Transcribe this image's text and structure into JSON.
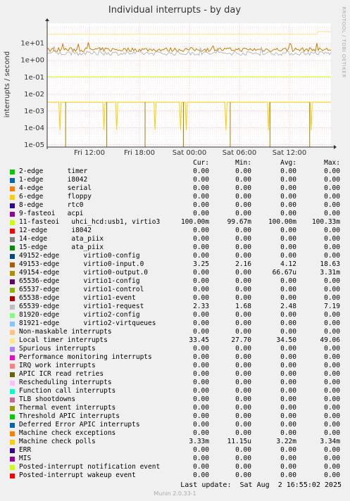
{
  "chart_data": {
    "type": "line",
    "title": "Individual interrupts - by day",
    "ylabel": "interrupts / second",
    "side_text": "RRDTOOL / TOBI OETIKER",
    "y_scale": "log",
    "ylim": [
      7e-06,
      150
    ],
    "y_ticks": [
      {
        "value": 10,
        "label": "1e+01"
      },
      {
        "value": 1,
        "label": "1e+00"
      },
      {
        "value": 0.1,
        "label": "1e-01"
      },
      {
        "value": 0.01,
        "label": "1e-02"
      },
      {
        "value": 0.001,
        "label": "1e-03"
      },
      {
        "value": 0.0001,
        "label": "1e-04"
      },
      {
        "value": 1e-05,
        "label": "1e-05"
      }
    ],
    "x_ticks": [
      "Fri 12:00",
      "Fri 18:00",
      "Sat 00:00",
      "Sat 06:00",
      "Sat 12:00"
    ],
    "grid": true,
    "series": [
      {
        "name": "Local timer interrupts",
        "color": "#ffe680",
        "level": 34.5,
        "style": "flat"
      },
      {
        "name": "49153-edge",
        "color": "#cc7a00",
        "level": 4.12,
        "style": "noisy"
      },
      {
        "name": "65539-edge",
        "color": "#b8b8b8",
        "level": 2.48,
        "style": "noisy"
      },
      {
        "name": "11-fasteoi",
        "color": "#ccff00",
        "level": 0.1,
        "style": "flat"
      },
      {
        "name": "Machine check polls",
        "color": "#ffcc00",
        "level": 0.00322,
        "style": "dips"
      },
      {
        "name": "49154-edge",
        "color": "#a08000",
        "level": 6.67e-05,
        "style": "spikes"
      }
    ]
  },
  "legend": {
    "headers": {
      "cur": "Cur:",
      "min": "Min:",
      "avg": "Avg:",
      "max": "Max:"
    },
    "rows": [
      {
        "name": "2-edge      timer",
        "color": "#00cc00",
        "cur": "0.00",
        "min": "0.00",
        "avg": "0.00",
        "max": "0.00"
      },
      {
        "name": "1-edge      i8042",
        "color": "#0066b3",
        "cur": "0.00",
        "min": "0.00",
        "avg": "0.00",
        "max": "0.00"
      },
      {
        "name": "4-edge      serial",
        "color": "#ff8000",
        "cur": "0.00",
        "min": "0.00",
        "avg": "0.00",
        "max": "0.00"
      },
      {
        "name": "6-edge      floppy",
        "color": "#ffcc00",
        "cur": "0.00",
        "min": "0.00",
        "avg": "0.00",
        "max": "0.00"
      },
      {
        "name": "8-edge      rtc0",
        "color": "#330099",
        "cur": "0.00",
        "min": "0.00",
        "avg": "0.00",
        "max": "0.00"
      },
      {
        "name": "9-fasteoi   acpi",
        "color": "#990099",
        "cur": "0.00",
        "min": "0.00",
        "avg": "0.00",
        "max": "0.00"
      },
      {
        "name": "11-fasteoi   uhci_hcd:usb1, virtio3",
        "color": "#ccff00",
        "cur": "100.00m",
        "min": "99.67m",
        "avg": "100.00m",
        "max": "100.33m"
      },
      {
        "name": "12-edge      i8042",
        "color": "#ff0000",
        "cur": "0.00",
        "min": "0.00",
        "avg": "0.00",
        "max": "0.00"
      },
      {
        "name": "14-edge      ata_piix",
        "color": "#808080",
        "cur": "0.00",
        "min": "0.00",
        "avg": "0.00",
        "max": "0.00"
      },
      {
        "name": "15-edge      ata_piix",
        "color": "#008f00",
        "cur": "0.00",
        "min": "0.00",
        "avg": "0.00",
        "max": "0.00"
      },
      {
        "name": "49152-edge      virtio0-config",
        "color": "#00487d",
        "cur": "0.00",
        "min": "0.00",
        "avg": "0.00",
        "max": "0.00"
      },
      {
        "name": "49153-edge      virtio0-input.0",
        "color": "#b35a00",
        "cur": "3.25",
        "min": "2.16",
        "avg": "4.12",
        "max": "18.63"
      },
      {
        "name": "49154-edge      virtio0-output.0",
        "color": "#b38f00",
        "cur": "0.00",
        "min": "0.00",
        "avg": "66.67u",
        "max": "3.31m"
      },
      {
        "name": "65536-edge      virtio1-config",
        "color": "#6b006b",
        "cur": "0.00",
        "min": "0.00",
        "avg": "0.00",
        "max": "0.00"
      },
      {
        "name": "65537-edge      virtio1-control",
        "color": "#8fb300",
        "cur": "0.00",
        "min": "0.00",
        "avg": "0.00",
        "max": "0.00"
      },
      {
        "name": "65538-edge      virtio1-event",
        "color": "#b30000",
        "cur": "0.00",
        "min": "0.00",
        "avg": "0.00",
        "max": "0.00"
      },
      {
        "name": "65539-edge      virtio1-request",
        "color": "#bebebe",
        "cur": "2.33",
        "min": "1.68",
        "avg": "2.48",
        "max": "7.19"
      },
      {
        "name": "81920-edge      virtio2-config",
        "color": "#80ff80",
        "cur": "0.00",
        "min": "0.00",
        "avg": "0.00",
        "max": "0.00"
      },
      {
        "name": "81921-edge      virtio2-virtqueues",
        "color": "#80c9ff",
        "cur": "0.00",
        "min": "0.00",
        "avg": "0.00",
        "max": "0.00"
      },
      {
        "name": "Non-maskable interrupts",
        "color": "#ffc080",
        "cur": "0.00",
        "min": "0.00",
        "avg": "0.00",
        "max": "0.00"
      },
      {
        "name": "Local timer interrupts",
        "color": "#ffe680",
        "cur": "33.45",
        "min": "27.70",
        "avg": "34.50",
        "max": "49.06"
      },
      {
        "name": "Spurious interrupts",
        "color": "#aa80ff",
        "cur": "0.00",
        "min": "0.00",
        "avg": "0.00",
        "max": "0.00"
      },
      {
        "name": "Performance monitoring interrupts",
        "color": "#ee00cc",
        "cur": "0.00",
        "min": "0.00",
        "avg": "0.00",
        "max": "0.00"
      },
      {
        "name": "IRQ work interrupts",
        "color": "#ff8080",
        "cur": "0.00",
        "min": "0.00",
        "avg": "0.00",
        "max": "0.00"
      },
      {
        "name": "APIC ICR read retries",
        "color": "#666600",
        "cur": "0.00",
        "min": "0.00",
        "avg": "0.00",
        "max": "0.00"
      },
      {
        "name": "Rescheduling interrupts",
        "color": "#ffbfff",
        "cur": "0.00",
        "min": "0.00",
        "avg": "0.00",
        "max": "0.00"
      },
      {
        "name": "Function call interrupts",
        "color": "#00ffcc",
        "cur": "0.00",
        "min": "0.00",
        "avg": "0.00",
        "max": "0.00"
      },
      {
        "name": "TLB shootdowns",
        "color": "#cc6699",
        "cur": "0.00",
        "min": "0.00",
        "avg": "0.00",
        "max": "0.00"
      },
      {
        "name": "Thermal event interrupts",
        "color": "#999900",
        "cur": "0.00",
        "min": "0.00",
        "avg": "0.00",
        "max": "0.00"
      },
      {
        "name": "Threshold APIC interrupts",
        "color": "#00cc00",
        "cur": "0.00",
        "min": "0.00",
        "avg": "0.00",
        "max": "0.00"
      },
      {
        "name": "Deferred Error APIC interrupts",
        "color": "#0066b3",
        "cur": "0.00",
        "min": "0.00",
        "avg": "0.00",
        "max": "0.00"
      },
      {
        "name": "Machine check exceptions",
        "color": "#ff8000",
        "cur": "0.00",
        "min": "0.00",
        "avg": "0.00",
        "max": "0.00"
      },
      {
        "name": "Machine check polls",
        "color": "#ffcc00",
        "cur": "3.33m",
        "min": "11.15u",
        "avg": "3.22m",
        "max": "3.34m"
      },
      {
        "name": "ERR",
        "color": "#330099",
        "cur": "0.00",
        "min": "0.00",
        "avg": "0.00",
        "max": "0.00"
      },
      {
        "name": "MIS",
        "color": "#990099",
        "cur": "0.00",
        "min": "0.00",
        "avg": "0.00",
        "max": "0.00"
      },
      {
        "name": "Posted-interrupt notification event",
        "color": "#ccff00",
        "cur": "0.00",
        "min": "0.00",
        "avg": "0.00",
        "max": "0.00"
      },
      {
        "name": "Posted-interrupt wakeup event",
        "color": "#ff0000",
        "cur": "0.00",
        "min": "0.00",
        "avg": "0.00",
        "max": "0.00"
      }
    ]
  },
  "footer": {
    "last_update": "Last update:  Sat Aug  2 16:55:02 2025",
    "version": "Munin 2.0.33-1"
  }
}
